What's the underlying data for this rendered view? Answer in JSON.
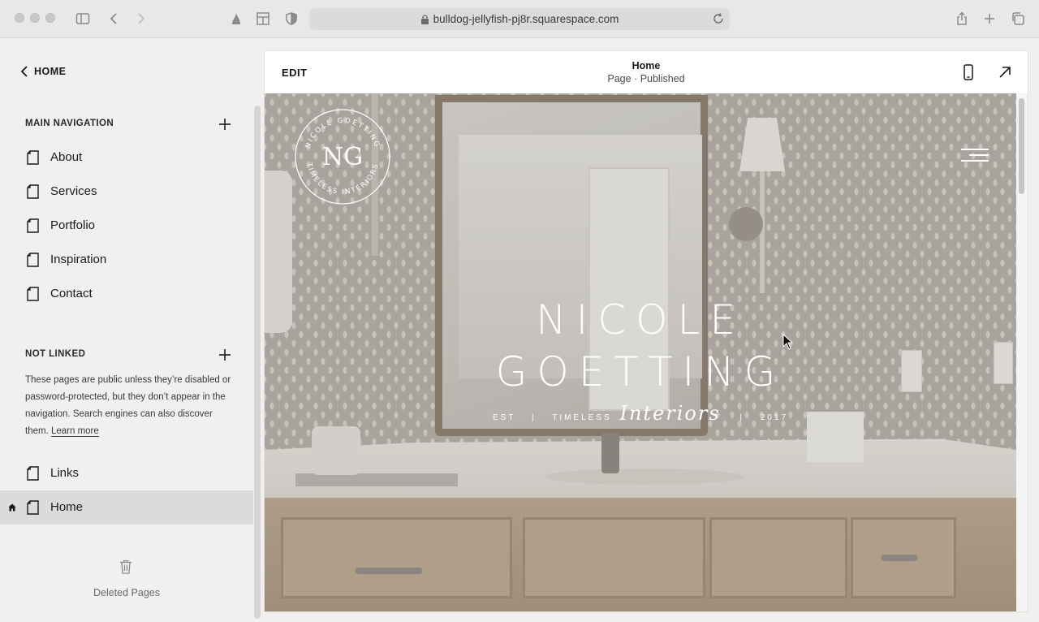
{
  "browser": {
    "url": "bulldog-jellyfish-pj8r.squarespace.com"
  },
  "sidebar": {
    "back_label": "HOME",
    "main_nav": {
      "heading": "MAIN NAVIGATION",
      "items": [
        {
          "label": "About"
        },
        {
          "label": "Services"
        },
        {
          "label": "Portfolio"
        },
        {
          "label": "Inspiration"
        },
        {
          "label": "Contact"
        }
      ]
    },
    "not_linked": {
      "heading": "NOT LINKED",
      "description": "These pages are public unless they’re disabled or password-protected, but they don’t appear in the navigation. Search engines can also discover them.",
      "learn_more": "Learn more",
      "items": [
        {
          "label": "Links"
        },
        {
          "label": "Home",
          "active": true
        }
      ]
    },
    "deleted_label": "Deleted Pages"
  },
  "preview": {
    "edit_label": "EDIT",
    "page_title": "Home",
    "page_status": "Page · Published"
  },
  "hero": {
    "logo_text_top": "NICOLE GOETTING",
    "logo_text_bottom": "TIMELESS INTERIORS",
    "logo_monogram": "NG",
    "brand_line1": "NICOLE",
    "brand_line2": "GOETTING",
    "tag_est": "EST",
    "tag_timeless": "TIMELESS",
    "tag_script": "Interiors",
    "tag_year": "2017"
  },
  "colors": {
    "sidebar_bg": "#f1f0ef",
    "active_row": "#dcdbda",
    "hero_wall": "#b3aea8"
  }
}
